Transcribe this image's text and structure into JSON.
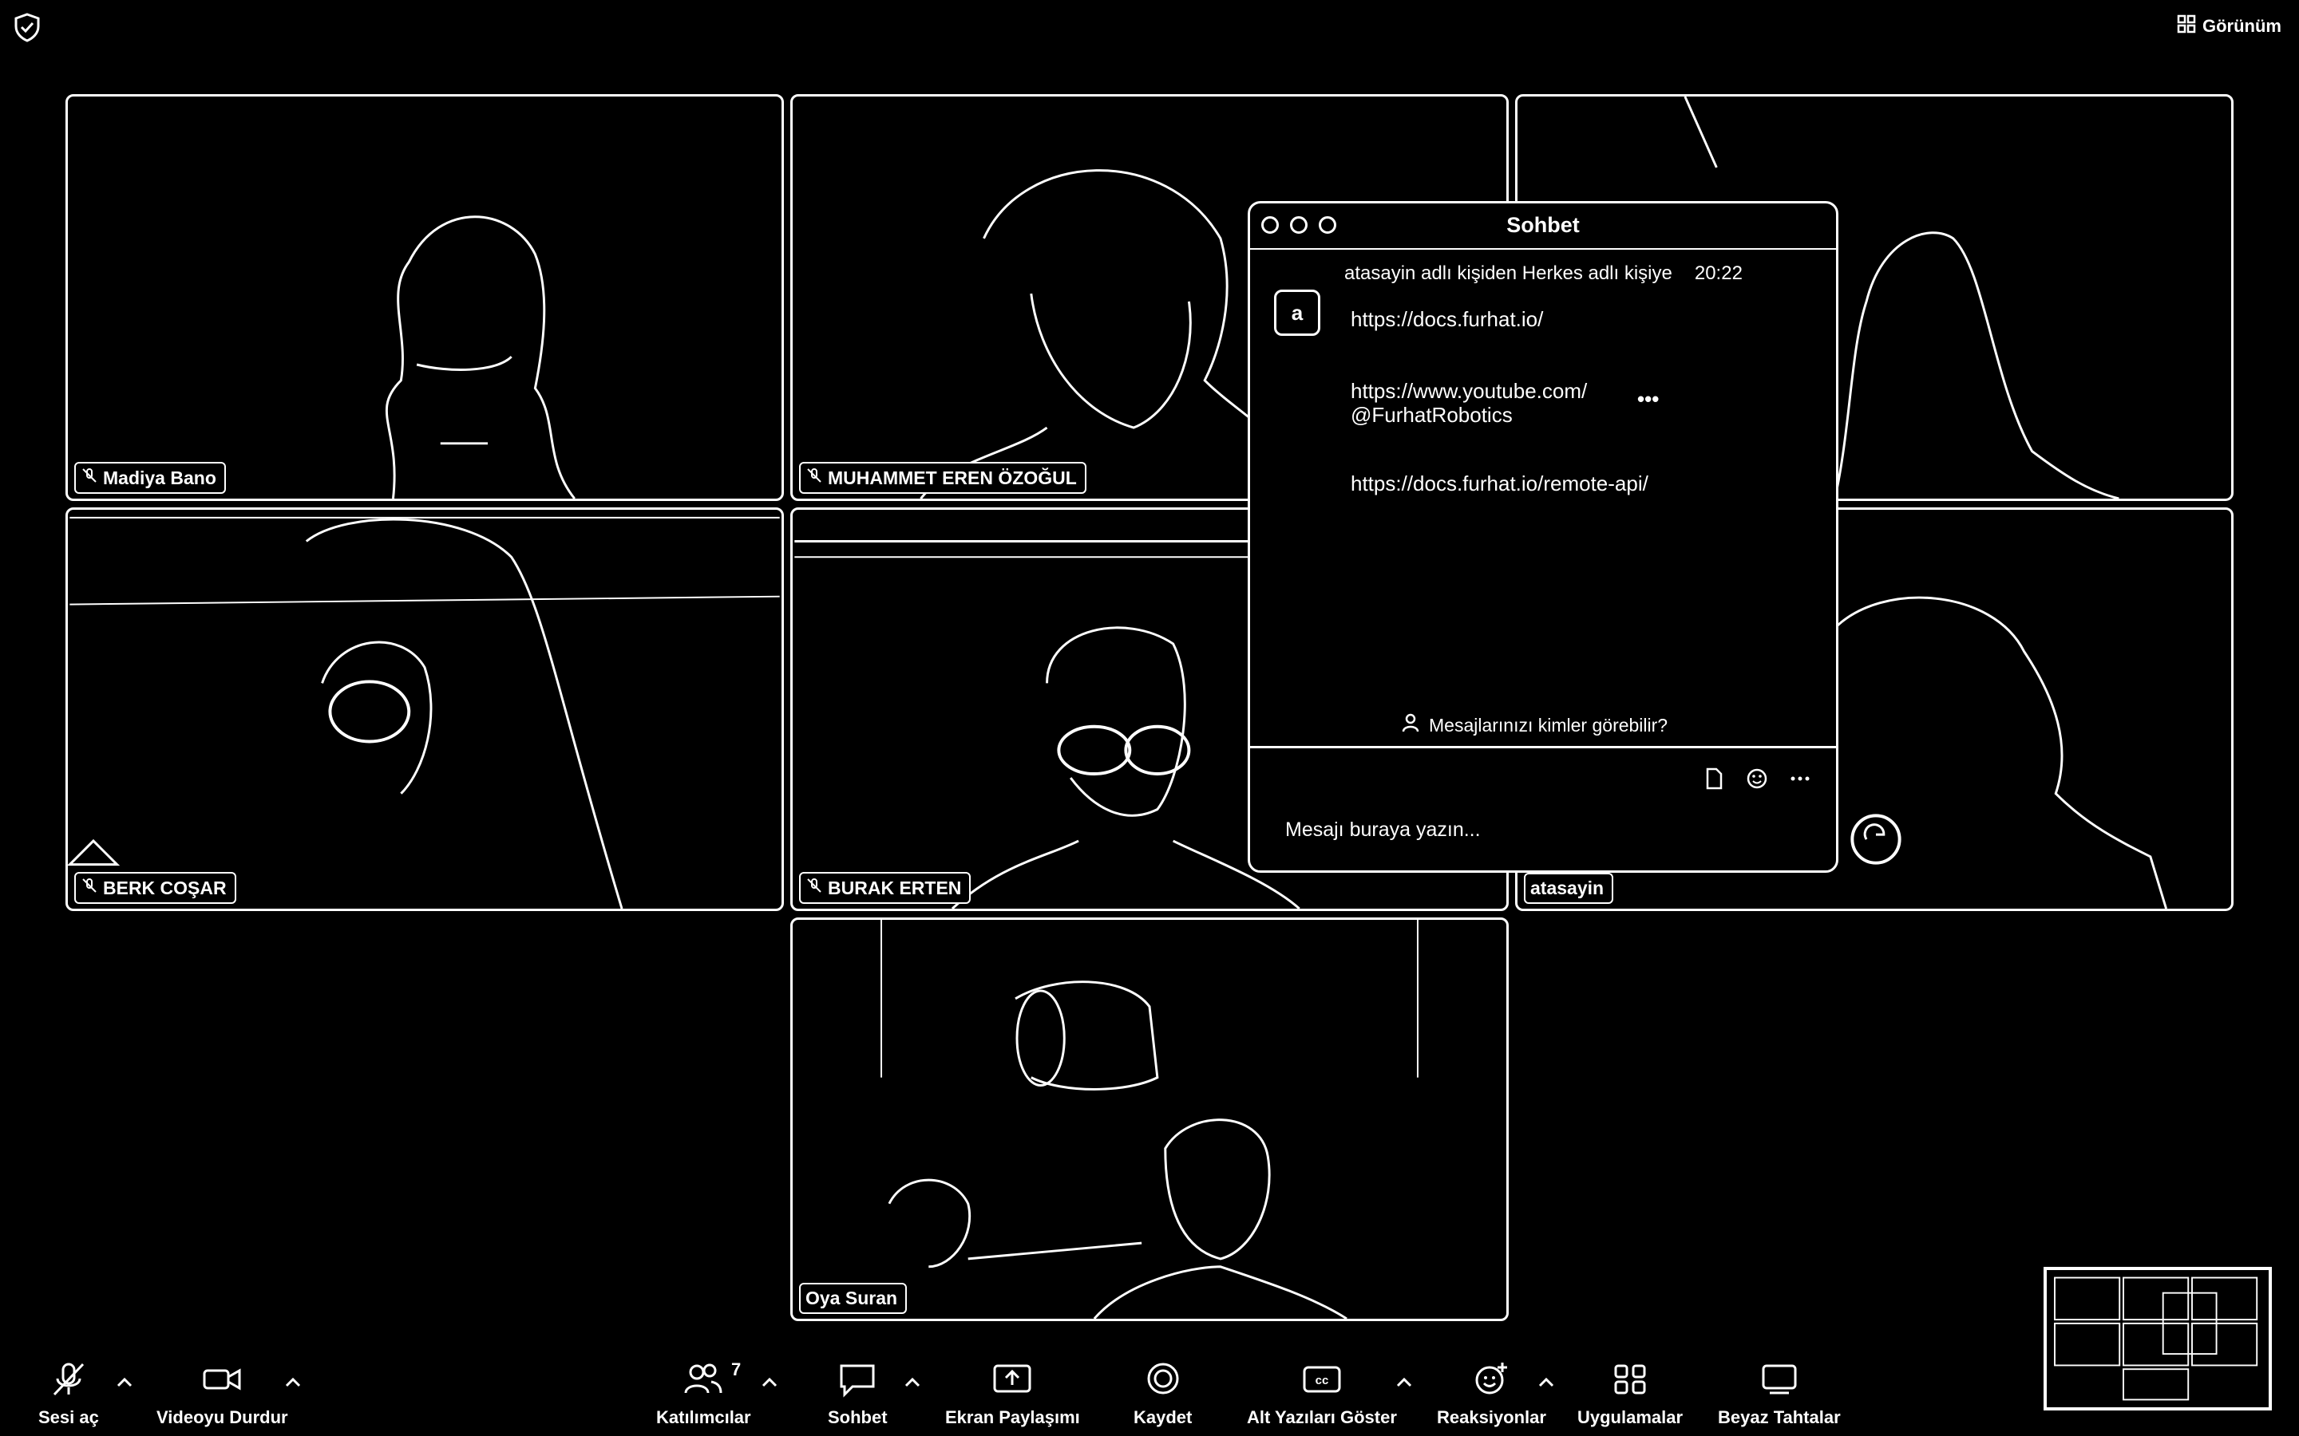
{
  "top_bar": {
    "view_label": "Görünüm"
  },
  "participants": [
    {
      "name": "Madiya Bano",
      "muted": true
    },
    {
      "name": "MUHAMMET EREN ÖZOĞUL",
      "muted": true
    },
    {
      "name": "",
      "muted": false
    },
    {
      "name": "BERK COŞAR",
      "muted": true
    },
    {
      "name": "BURAK ERTEN",
      "muted": true
    },
    {
      "name": "atasayin",
      "muted": false
    },
    {
      "name": "Oya Suran",
      "muted": false
    }
  ],
  "chat": {
    "title": "Sohbet",
    "message_header": "atasayin adlı kişiden Herkes adlı kişiye",
    "time": "20:22",
    "avatar_letter": "a",
    "links": [
      "https://docs.furhat.io/",
      "https://www.youtube.com/",
      "@FurhatRobotics",
      "https://docs.furhat.io/remote-api/"
    ],
    "more": "•••",
    "privacy_text": "Mesajlarınızı kimler görebilir?",
    "input_placeholder": "Mesajı buraya yazın..."
  },
  "toolbar": {
    "mute": "Sesi aç",
    "video": "Videoyu Durdur",
    "participants": "Katılımcılar",
    "participants_count": "7",
    "chat": "Sohbet",
    "share": "Ekran Paylaşımı",
    "record": "Kaydet",
    "captions": "Alt Yazıları Göster",
    "reactions": "Reaksiyonlar",
    "apps": "Uygulamalar",
    "whiteboards": "Beyaz Tahtalar"
  }
}
